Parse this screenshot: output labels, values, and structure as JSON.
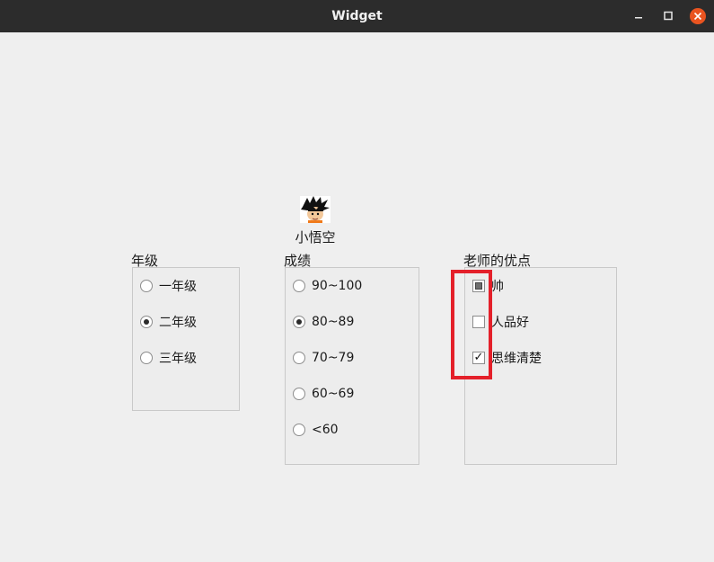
{
  "window": {
    "title": "Widget",
    "minimize_icon": "minimize-icon",
    "maximize_icon": "maximize-icon",
    "close_icon": "close-icon",
    "close_color": "#e95420"
  },
  "avatar": {
    "name": "小悟空",
    "icon": "goku-avatar"
  },
  "grade_group": {
    "title": "年级",
    "options": [
      {
        "label": "一年级",
        "checked": false
      },
      {
        "label": "二年级",
        "checked": true
      },
      {
        "label": "三年级",
        "checked": false
      }
    ]
  },
  "score_group": {
    "title": "成绩",
    "options": [
      {
        "label": "90~100",
        "checked": false
      },
      {
        "label": "80~89",
        "checked": true
      },
      {
        "label": "70~79",
        "checked": false
      },
      {
        "label": "60~69",
        "checked": false
      },
      {
        "label": "<60",
        "checked": false
      }
    ]
  },
  "teacher_group": {
    "title": "老师的优点",
    "options": [
      {
        "label": "帅",
        "state": "partial"
      },
      {
        "label": "人品好",
        "state": "unchecked"
      },
      {
        "label": "思维清楚",
        "state": "checked",
        "mark": "✓"
      }
    ]
  },
  "annotation": {
    "highlight_color": "#e4202a"
  }
}
